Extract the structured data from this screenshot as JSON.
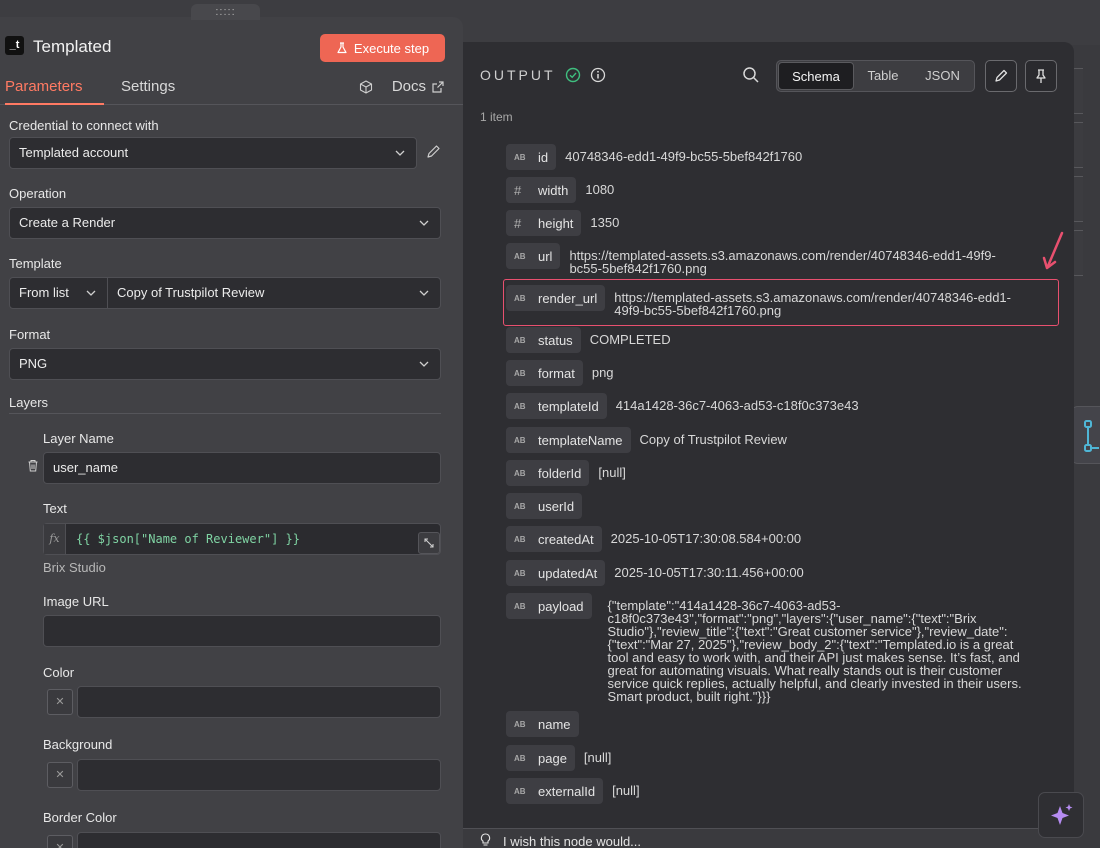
{
  "node": {
    "icon_text": "_t",
    "title": "Templated",
    "execute_label": "Execute step",
    "drag_handle": ":::::"
  },
  "tabs": {
    "parameters": "Parameters",
    "settings": "Settings",
    "docs": "Docs"
  },
  "form": {
    "credential_label": "Credential to connect with",
    "credential_value": "Templated account",
    "operation_label": "Operation",
    "operation_value": "Create a Render",
    "template_label": "Template",
    "template_mode": "From list",
    "template_value": "Copy of Trustpilot Review",
    "format_label": "Format",
    "format_value": "PNG",
    "layers_label": "Layers",
    "layer_name_label": "Layer Name",
    "layer_name_value": "user_name",
    "text_label": "Text",
    "fx": "fx",
    "text_expression": "{{ $json[\"Name of Reviewer\"] }}",
    "text_preview": "Brix Studio",
    "image_url_label": "Image URL",
    "color_label": "Color",
    "background_label": "Background",
    "border_color_label": "Border Color",
    "swatch_x": "✕"
  },
  "output": {
    "title": "OUTPUT",
    "items_count": "1 item",
    "views": [
      "Schema",
      "Table",
      "JSON"
    ],
    "active_view": "Schema",
    "fields": [
      {
        "type": "AB",
        "key": "id",
        "value": "40748346-edd1-49f9-bc55-5bef842f1760"
      },
      {
        "type": "#",
        "key": "width",
        "value": "1080"
      },
      {
        "type": "#",
        "key": "height",
        "value": "1350"
      },
      {
        "type": "AB",
        "key": "url",
        "value": "https://templated-assets.s3.amazonaws.com/render/40748346-edd1-49f9-",
        "value2": "bc55-5bef842f1760.png"
      },
      {
        "type": "AB",
        "key": "render_url",
        "value": "https://templated-assets.s3.amazonaws.com/render/40748346-edd1-",
        "value2": "49f9-bc55-5bef842f1760.png"
      },
      {
        "type": "AB",
        "key": "status",
        "value": "COMPLETED"
      },
      {
        "type": "AB",
        "key": "format",
        "value": "png"
      },
      {
        "type": "AB",
        "key": "templateId",
        "value": "414a1428-36c7-4063-ad53-c18f0c373e43"
      },
      {
        "type": "AB",
        "key": "templateName",
        "value": "Copy of Trustpilot Review"
      },
      {
        "type": "AB",
        "key": "folderId",
        "value": "[null]"
      },
      {
        "type": "AB",
        "key": "userId",
        "value": ""
      },
      {
        "type": "AB",
        "key": "createdAt",
        "value": "2025-10-05T17:30:08.584+00:00"
      },
      {
        "type": "AB",
        "key": "updatedAt",
        "value": "2025-10-05T17:30:11.456+00:00"
      },
      {
        "type": "AB",
        "key": "payload",
        "lines": [
          "{\"template\":\"414a1428-36c7-4063-ad53-",
          "c18f0c373e43\",\"format\":\"png\",\"layers\":{\"user_name\":{\"text\":\"Brix",
          "Studio\"},\"review_title\":{\"text\":\"Great customer service\"},\"review_date\":",
          "{\"text\":\"Mar 27, 2025\"},\"review_body_2\":{\"text\":\"Templated.io is a great",
          "tool and easy to work with, and their API just makes sense. It’s fast, and",
          "great for automating visuals. What really stands out is their customer",
          "service quick replies, actually helpful, and clearly invested in their users.",
          "Smart product, built right.\"}}}"
        ]
      },
      {
        "type": "AB",
        "key": "name",
        "value": ""
      },
      {
        "type": "AB",
        "key": "page",
        "value": "[null]"
      },
      {
        "type": "AB",
        "key": "externalId",
        "value": "[null]"
      }
    ]
  },
  "footer": {
    "wish": "I wish this node would..."
  },
  "colors": {
    "accent": "#ee6654",
    "highlight": "#e8506f",
    "expression": "#7fd3a3"
  }
}
